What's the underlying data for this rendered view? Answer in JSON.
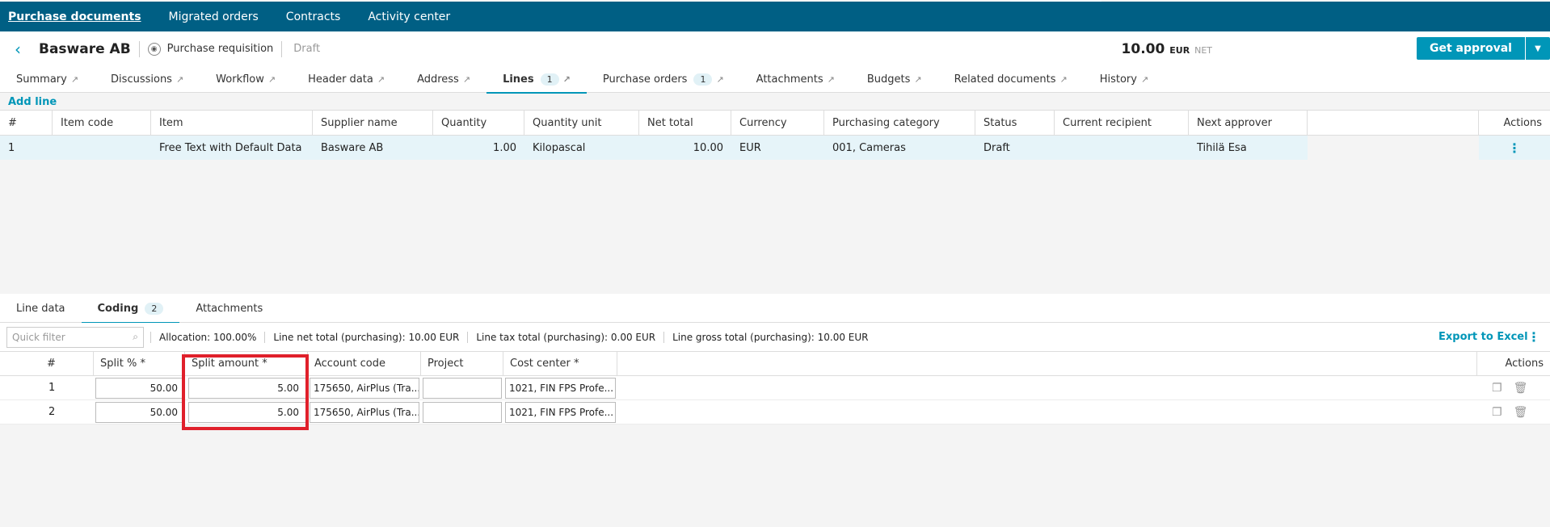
{
  "topnav": [
    "Purchase documents",
    "Migrated orders",
    "Contracts",
    "Activity center"
  ],
  "header": {
    "title": "Basware AB",
    "doc_type": "Purchase requisition",
    "status": "Draft",
    "amount": "10.00",
    "currency": "EUR",
    "net": "NET",
    "approve_label": "Get approval"
  },
  "tabs": [
    {
      "label": "Summary"
    },
    {
      "label": "Discussions"
    },
    {
      "label": "Workflow"
    },
    {
      "label": "Header data"
    },
    {
      "label": "Address"
    },
    {
      "label": "Lines",
      "count": "1"
    },
    {
      "label": "Purchase orders",
      "count": "1"
    },
    {
      "label": "Attachments"
    },
    {
      "label": "Budgets"
    },
    {
      "label": "Related documents"
    },
    {
      "label": "History"
    }
  ],
  "add_line": "Add line",
  "lines": {
    "columns": [
      "#",
      "Item code",
      "Item",
      "Supplier name",
      "Quantity",
      "Quantity unit",
      "Net total",
      "Currency",
      "Purchasing category",
      "Status",
      "Current recipient",
      "Next approver",
      "",
      "Actions"
    ],
    "rows": [
      [
        "1",
        "",
        "Free Text with Default Data",
        "Basware AB",
        "1.00",
        "Kilopascal",
        "10.00",
        "EUR",
        "001, Cameras",
        "Draft",
        "",
        "Tihilä Esa"
      ]
    ]
  },
  "subtabs": [
    {
      "label": "Line data"
    },
    {
      "label": "Coding",
      "count": "2"
    },
    {
      "label": "Attachments"
    }
  ],
  "toolbar": {
    "quick_filter_placeholder": "Quick filter",
    "allocation": "Allocation: 100.00%",
    "net_total": "Line net total (purchasing): 10.00 EUR",
    "tax_total": "Line tax total (purchasing): 0.00 EUR",
    "gross_total": "Line gross total (purchasing): 10.00 EUR",
    "export": "Export to Excel"
  },
  "coding": {
    "columns": [
      "#",
      "Split % *",
      "Split amount *",
      "Account code",
      "Project",
      "Cost center *",
      "Actions"
    ],
    "rows": [
      {
        "num": "1",
        "split_pct": "50.00",
        "split_amount": "5.00",
        "account": "175650, AirPlus (Tra...",
        "project": "",
        "cost_center": "1021, FIN FPS Profe..."
      },
      {
        "num": "2",
        "split_pct": "50.00",
        "split_amount": "5.00",
        "account": "175650, AirPlus (Tra...",
        "project": "",
        "cost_center": "1021, FIN FPS Profe..."
      }
    ]
  },
  "colors": {
    "nav": "#005f84",
    "accent": "#0096b8",
    "highlight": "#e0202b"
  }
}
